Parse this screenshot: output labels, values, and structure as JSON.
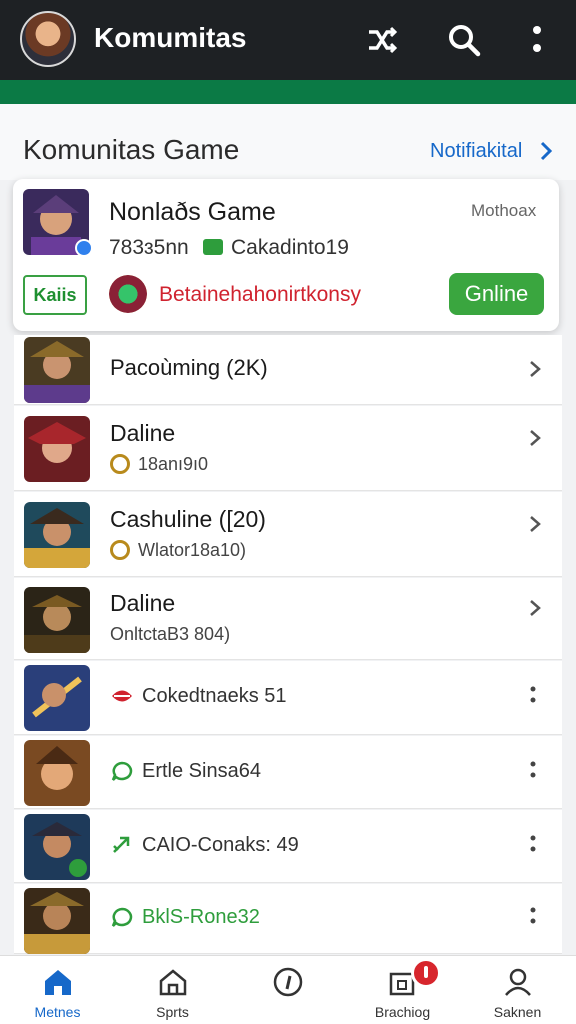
{
  "app": {
    "title": "Komumitas"
  },
  "section": {
    "title": "Komunitas Game",
    "link_label": "Notifiakital"
  },
  "featured": {
    "name": "Nonlaðs Game",
    "meta": "Mothoax",
    "count": "783ɜ5nn",
    "stat": "Cakadinto19",
    "tag": "Kaiis",
    "description": "Betainehahonirtkonsy",
    "online_label": "Gnline",
    "colors": {
      "online": "#3aa63f",
      "description": "#d0232f"
    }
  },
  "rows": [
    {
      "title": "Pacoùming (2K)"
    },
    {
      "title": "Daline",
      "sub": "18anı9ı0"
    },
    {
      "title": "Cashuline ([20)",
      "sub": "Wlator18a10)"
    },
    {
      "title": "Daline",
      "sub": "OnltctaB3 804)"
    },
    {
      "status": "Cokedtnaeks 51",
      "icon": "lips-icon"
    },
    {
      "status": "Ertle Sinsa64",
      "icon": "chat-bubble-icon"
    },
    {
      "status": "CAIO-Conaks: 49",
      "icon": "arrow-icon"
    },
    {
      "status": "BklS-Rone32",
      "icon": "chat-bubble-icon"
    }
  ],
  "nav": [
    {
      "label": "Metnes",
      "icon": "home-icon"
    },
    {
      "label": "Sprts",
      "icon": "house-outline-icon"
    },
    {
      "label": "",
      "icon": "compass-icon"
    },
    {
      "label": "Brachiog",
      "icon": "inbox-icon"
    },
    {
      "label": "Saknen",
      "icon": "profile-icon"
    }
  ],
  "colors": {
    "appbar": "#1e2124",
    "accent_green": "#0b7a45",
    "link_blue": "#1668c9"
  }
}
